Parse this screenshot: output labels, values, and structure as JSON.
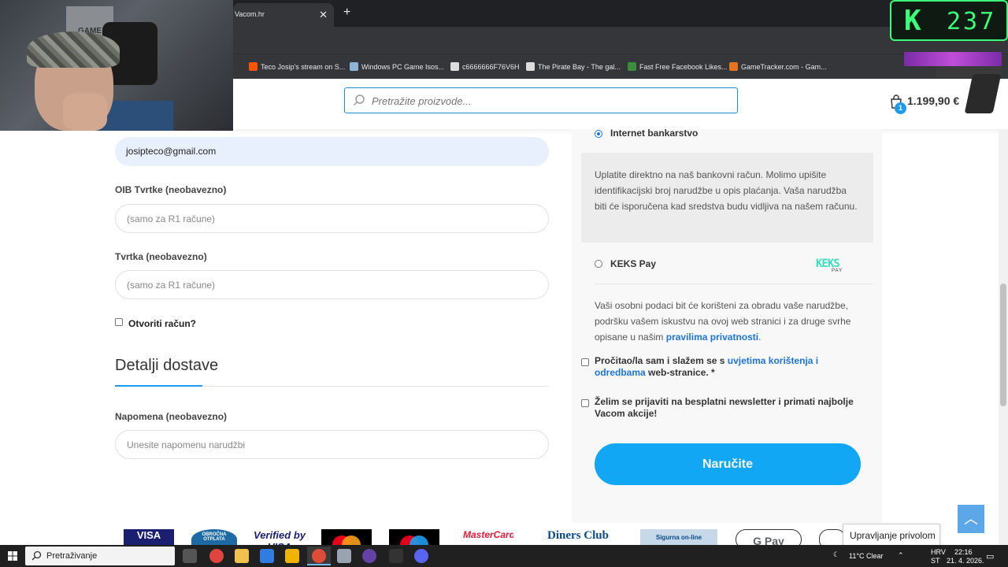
{
  "browser": {
    "active_tab": "Vacom.hr",
    "bookmarks": [
      {
        "label": "Teco Josip's stream on S...",
        "color": "#ff5500"
      },
      {
        "label": "Windows PC Game Isos...",
        "color": "#8fb3d9"
      },
      {
        "label": "c6666666F76V6H",
        "color": "#dddddd"
      },
      {
        "label": "The Pirate Bay - The gal...",
        "color": "#dddddd"
      },
      {
        "label": "Fast Free Facebook Likes...",
        "color": "#3a8f3a"
      },
      {
        "label": "GameTracker.com - Gam...",
        "color": "#e8731e"
      }
    ]
  },
  "overlay": {
    "webcam_poster_text": "GAME",
    "counter_letter": "K",
    "counter_value": "237"
  },
  "header": {
    "search_placeholder": "Pretražite proizvode...",
    "cart_count": "1",
    "cart_total": "1.199,90 €"
  },
  "billing": {
    "email_value": "josipteco@gmail.com",
    "oib_label": "OIB Tvrtke (neobavezno)",
    "oib_placeholder": "(samo za R1 račune)",
    "company_label": "Tvrtka (neobavezno)",
    "company_placeholder": "(samo za R1 račune)",
    "create_account_label": "Otvoriti račun?"
  },
  "shipping": {
    "title": "Detalji dostave",
    "note_label": "Napomena (neobavezno)",
    "note_placeholder": "Unesite napomenu narudžbi"
  },
  "payment": {
    "bank_label": "Internet bankarstvo",
    "bank_description": "Uplatite direktno na naš bankovni račun. Molimo upišite identifikacijski broj narudžbe u opis plaćanja. Vaša narudžba biti će isporučena kad sredstva budu vidljiva na našem računu.",
    "keks_label": "KEKS Pay",
    "keks_logo_top": "KEKS",
    "keks_logo_bottom": "PAY",
    "privacy_text": "Vaši osobni podaci bit će korišteni za obradu vaše narudžbe, podršku vašem iskustvu na ovoj web stranici i za druge svrhe opisane u našim ",
    "privacy_link": "pravilima privatnosti",
    "privacy_end": ".",
    "terms_pre": "Pročitao/la sam i slažem se s ",
    "terms_link": "uvjetima korištenja i odredbama",
    "terms_post": " web-stranice. *",
    "newsletter_label": "Želim se prijaviti na besplatni newsletter i primati najbolje Vacom akcije!",
    "order_button": "Naručite"
  },
  "footer": {
    "logos": [
      "VISA",
      "OBROČNA OTPLATA",
      "Verified by VISA",
      "",
      "",
      "MasterCard.",
      "Diners Club",
      "Sigurna on-line",
      "G Pay",
      ""
    ],
    "privacy_popup": "Upravljanje privolom"
  },
  "taskbar": {
    "search_text": "Pretraživanje",
    "weather": "11°C  Clear",
    "lang_top": "HRV",
    "lang_bottom": "ST",
    "time": "22:16",
    "date": "21. 4. 2026."
  }
}
